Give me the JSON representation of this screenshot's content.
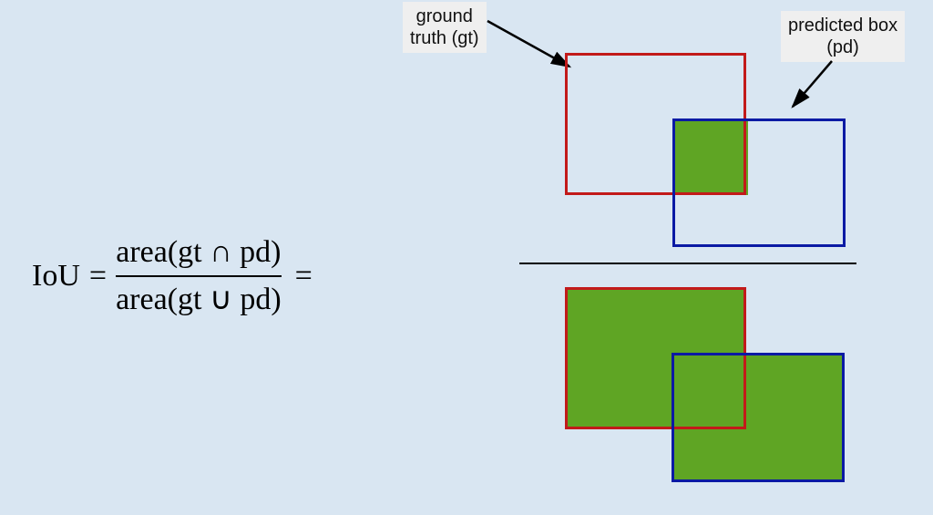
{
  "labels": {
    "gt": {
      "line1": "ground",
      "line2": "truth (gt)"
    },
    "pd": {
      "line1": "predicted box",
      "line2": "(pd)"
    }
  },
  "formula": {
    "lhs": "IoU",
    "eq1": "=",
    "numerator": "area(gt ∩ pd)",
    "denominator": "area(gt ∪ pd)",
    "eq2": "="
  },
  "colors": {
    "gt_border": "#c21a1a",
    "pd_border": "#0b1aa4",
    "area_fill": "#5fa524",
    "background": "#d9e6f2"
  },
  "diagram": {
    "description": "Intersection over Union: numerator is the overlapping area of ground-truth and predicted boxes; denominator is their union area.",
    "numerator_shape": "intersection rectangle",
    "denominator_shape": "union polygon"
  }
}
